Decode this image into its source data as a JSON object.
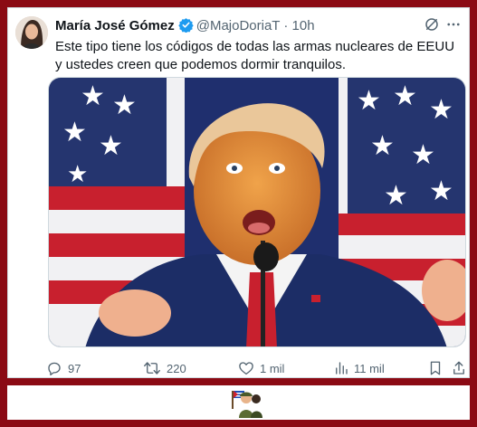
{
  "tweet": {
    "display_name": "María José Gómez",
    "handle": "@MajoDoriaT",
    "separator": "·",
    "time": "10h",
    "text": "Este tipo tiene los códigos de todas las armas nucleares de EEUU y ustedes creen que podemos dormir tranquilos.",
    "media_icon": "photo-of-man-speaking-at-podium-with-american-flags"
  },
  "actions": {
    "replies": "97",
    "retweets": "220",
    "likes": "1 mil",
    "views": "11 mil"
  },
  "icons": {
    "verified": "verified-badge-icon",
    "more": "grok-icon",
    "close": "more-icon",
    "reply": "reply-icon",
    "retweet": "retweet-icon",
    "like": "heart-icon",
    "views": "views-icon",
    "bookmark": "bookmark-icon",
    "share": "share-icon",
    "sticker": "soldier-with-flag-icon"
  },
  "colors": {
    "frame": "#8b0a14",
    "verified": "#1d9bf0",
    "text": "#0f1419",
    "muted": "#536471"
  }
}
